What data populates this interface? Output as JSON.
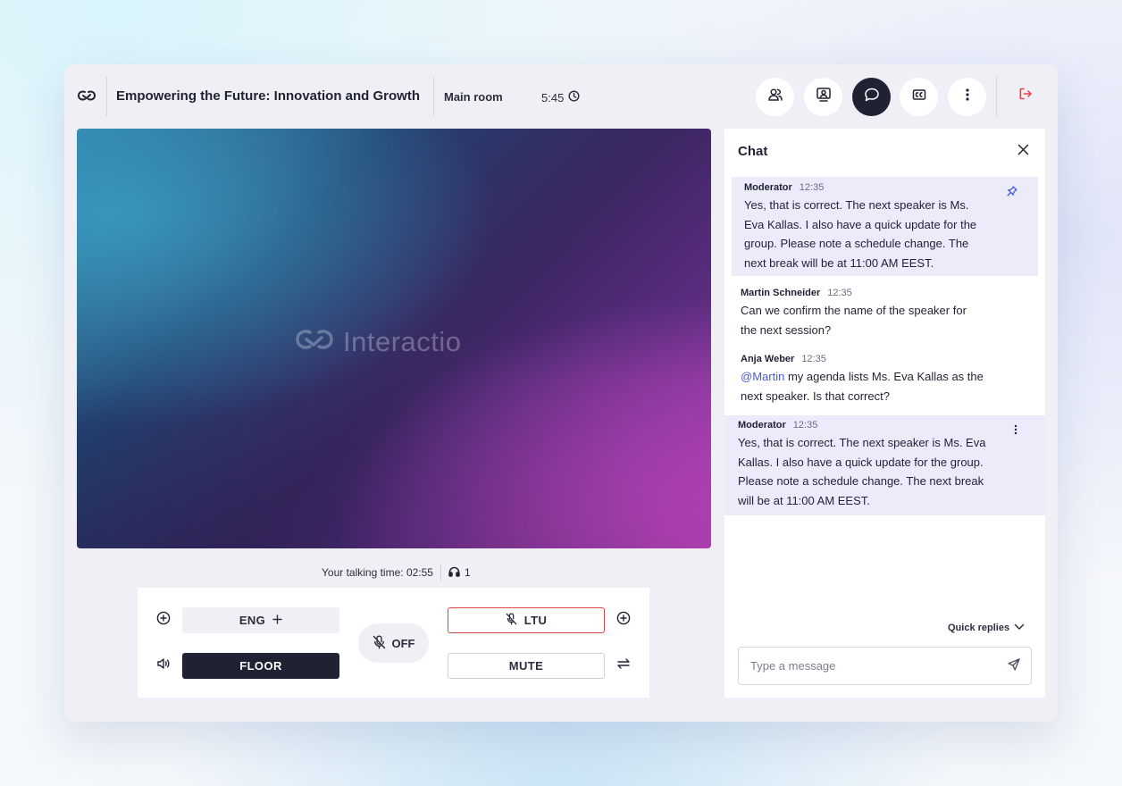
{
  "header": {
    "event_title": "Empowering the Future: Innovation and Growth",
    "room_name": "Main room",
    "timer": "5:45"
  },
  "toolbar": {
    "buttons": [
      "participants-icon",
      "speakers-icon",
      "chat-icon",
      "captions-icon",
      "more-icon"
    ],
    "active": "chat-icon",
    "leave_icon": "logout-icon"
  },
  "video": {
    "watermark": "Interactio"
  },
  "status": {
    "talking_time_label": "Your talking time: 02:55",
    "listeners": "1"
  },
  "controls": {
    "incoming_language": "ENG",
    "floor_label": "FLOOR",
    "mic_label": "OFF",
    "outgoing_language": "LTU",
    "mute_label": "MUTE"
  },
  "chat": {
    "title": "Chat",
    "messages": [
      {
        "author": "Moderator",
        "time": "12:35",
        "lines": [
          "Yes, that is correct. The next speaker is Ms.",
          "Eva Kallas. I also have a quick update for the",
          "group. Please note a schedule change. The",
          "next break will be at 11:00 AM EEST."
        ],
        "pinned": true
      },
      {
        "author": "Martin Schneider",
        "time": "12:35",
        "lines": [
          "Can we confirm the name of the speaker for",
          "the next session?"
        ]
      },
      {
        "author": "Anja Weber",
        "time": "12:35",
        "mention": "@Martin",
        "lines": [
          " my agenda lists Ms. Eva Kallas as the",
          "next speaker. Is that correct?"
        ]
      },
      {
        "author": "Moderator",
        "time": "12:35",
        "lines": [
          "Yes, that is correct. The next speaker is Ms. Eva",
          "Kallas. I also have a quick update for the group.",
          "Please note a schedule change. The next break",
          "will be at 11:00 AM EEST."
        ],
        "highlighted": true
      }
    ],
    "quick_replies_label": "Quick replies",
    "input_placeholder": "Type a message"
  },
  "colors": {
    "dark": "#1f2233",
    "accent_red": "#e0454a",
    "mention": "#4b5bd6",
    "highlight_bg": "#ebebfa"
  }
}
